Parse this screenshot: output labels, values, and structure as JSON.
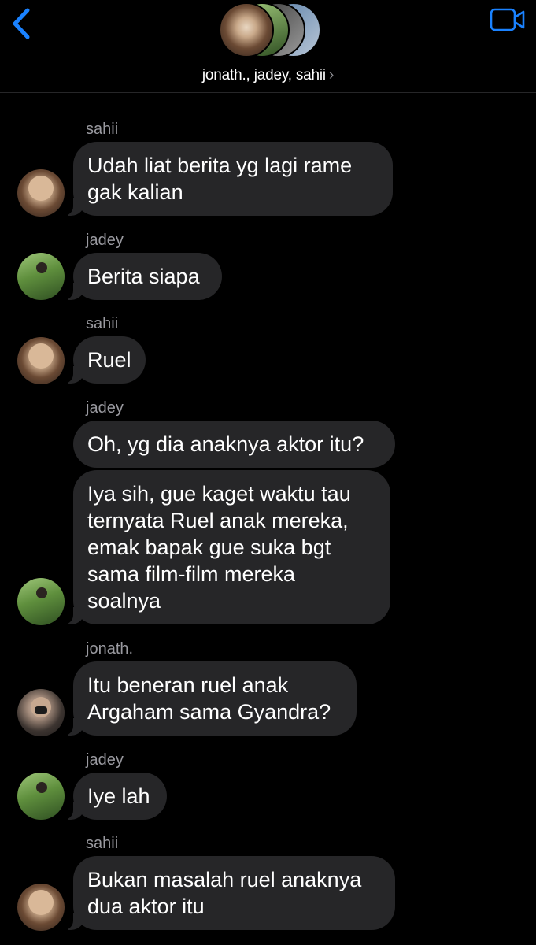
{
  "header": {
    "title": "jonath., jadey, sahii",
    "chevron": "›",
    "back_icon": "chevron-left-icon",
    "video_icon": "video-camera-icon",
    "accent_color": "#1a82ff"
  },
  "messages": [
    {
      "sender": "sahii",
      "text": "Udah liat berita yg lagi rame\ngak kalian"
    },
    {
      "sender": "jadey",
      "text": "Berita siapa"
    },
    {
      "sender": "sahii",
      "text": "Ruel"
    },
    {
      "sender": "jadey",
      "text": "Oh, yg dia anaknya aktor itu?"
    },
    {
      "sender": "",
      "text": "Iya sih, gue kaget waktu tau\nternyata Ruel anak mereka,\nemak bapak gue suka bgt\nsama film-film mereka\nsoalnya"
    },
    {
      "sender": "jonath.",
      "text": "Itu beneran ruel anak\nArgaham sama Gyandra?"
    },
    {
      "sender": "jadey",
      "text": "Iye lah"
    },
    {
      "sender": "sahii",
      "text": "Bukan masalah ruel anaknya\ndua aktor itu"
    }
  ]
}
